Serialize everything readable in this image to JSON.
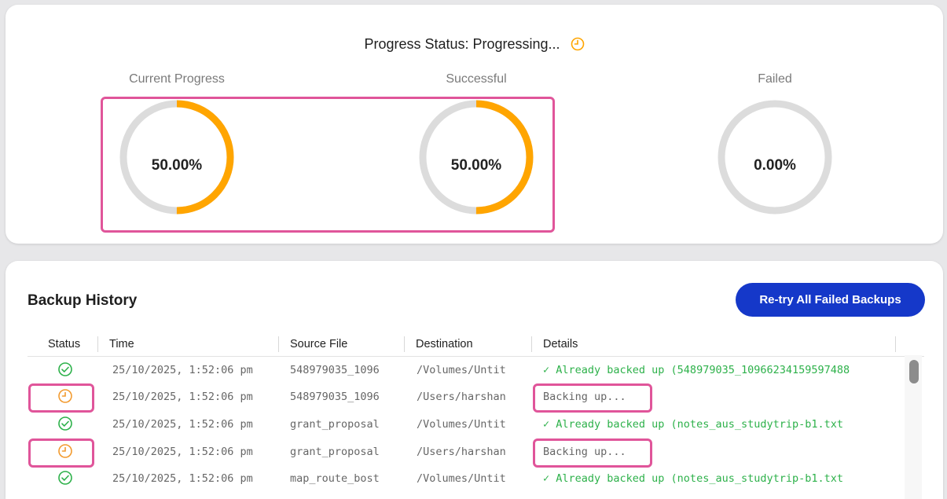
{
  "progress": {
    "title": "Progress Status: Progressing...",
    "status_icon": "clock-icon",
    "accent_color": "#ffa500",
    "track_color": "#dcdcdc",
    "gauges": [
      {
        "label": "Current Progress",
        "value_text": "50.00%",
        "fraction": 0.5
      },
      {
        "label": "Successful",
        "value_text": "50.00%",
        "fraction": 0.5
      },
      {
        "label": "Failed",
        "value_text": "0.00%",
        "fraction": 0.0
      }
    ]
  },
  "history": {
    "title": "Backup History",
    "retry_button": "Re-try All Failed Backups",
    "columns": [
      "Status",
      "Time",
      "Source File",
      "Destination",
      "Details"
    ],
    "rows": [
      {
        "status": "success",
        "time": "25/10/2025, 1:52:06 pm",
        "source": "548979035_1096",
        "destination": "/Volumes/Untit",
        "details": "✓ Already backed up (548979035_10966234159597488"
      },
      {
        "status": "pending",
        "time": "25/10/2025, 1:52:06 pm",
        "source": "548979035_1096",
        "destination": "/Users/harshan",
        "details": "Backing up..."
      },
      {
        "status": "success",
        "time": "25/10/2025, 1:52:06 pm",
        "source": "grant_proposal",
        "destination": "/Volumes/Untit",
        "details": "✓ Already backed up (notes_aus_studytrip-b1.txt"
      },
      {
        "status": "pending",
        "time": "25/10/2025, 1:52:06 pm",
        "source": "grant_proposal",
        "destination": "/Users/harshan",
        "details": "Backing up..."
      },
      {
        "status": "success",
        "time": "25/10/2025, 1:52:06 pm",
        "source": "map_route_bost",
        "destination": "/Volumes/Untit",
        "details": "✓ Already backed up (notes_aus_studytrip-b1.txt"
      }
    ],
    "status_colors": {
      "success": "#2db14a",
      "pending": "#f29a2e"
    }
  }
}
